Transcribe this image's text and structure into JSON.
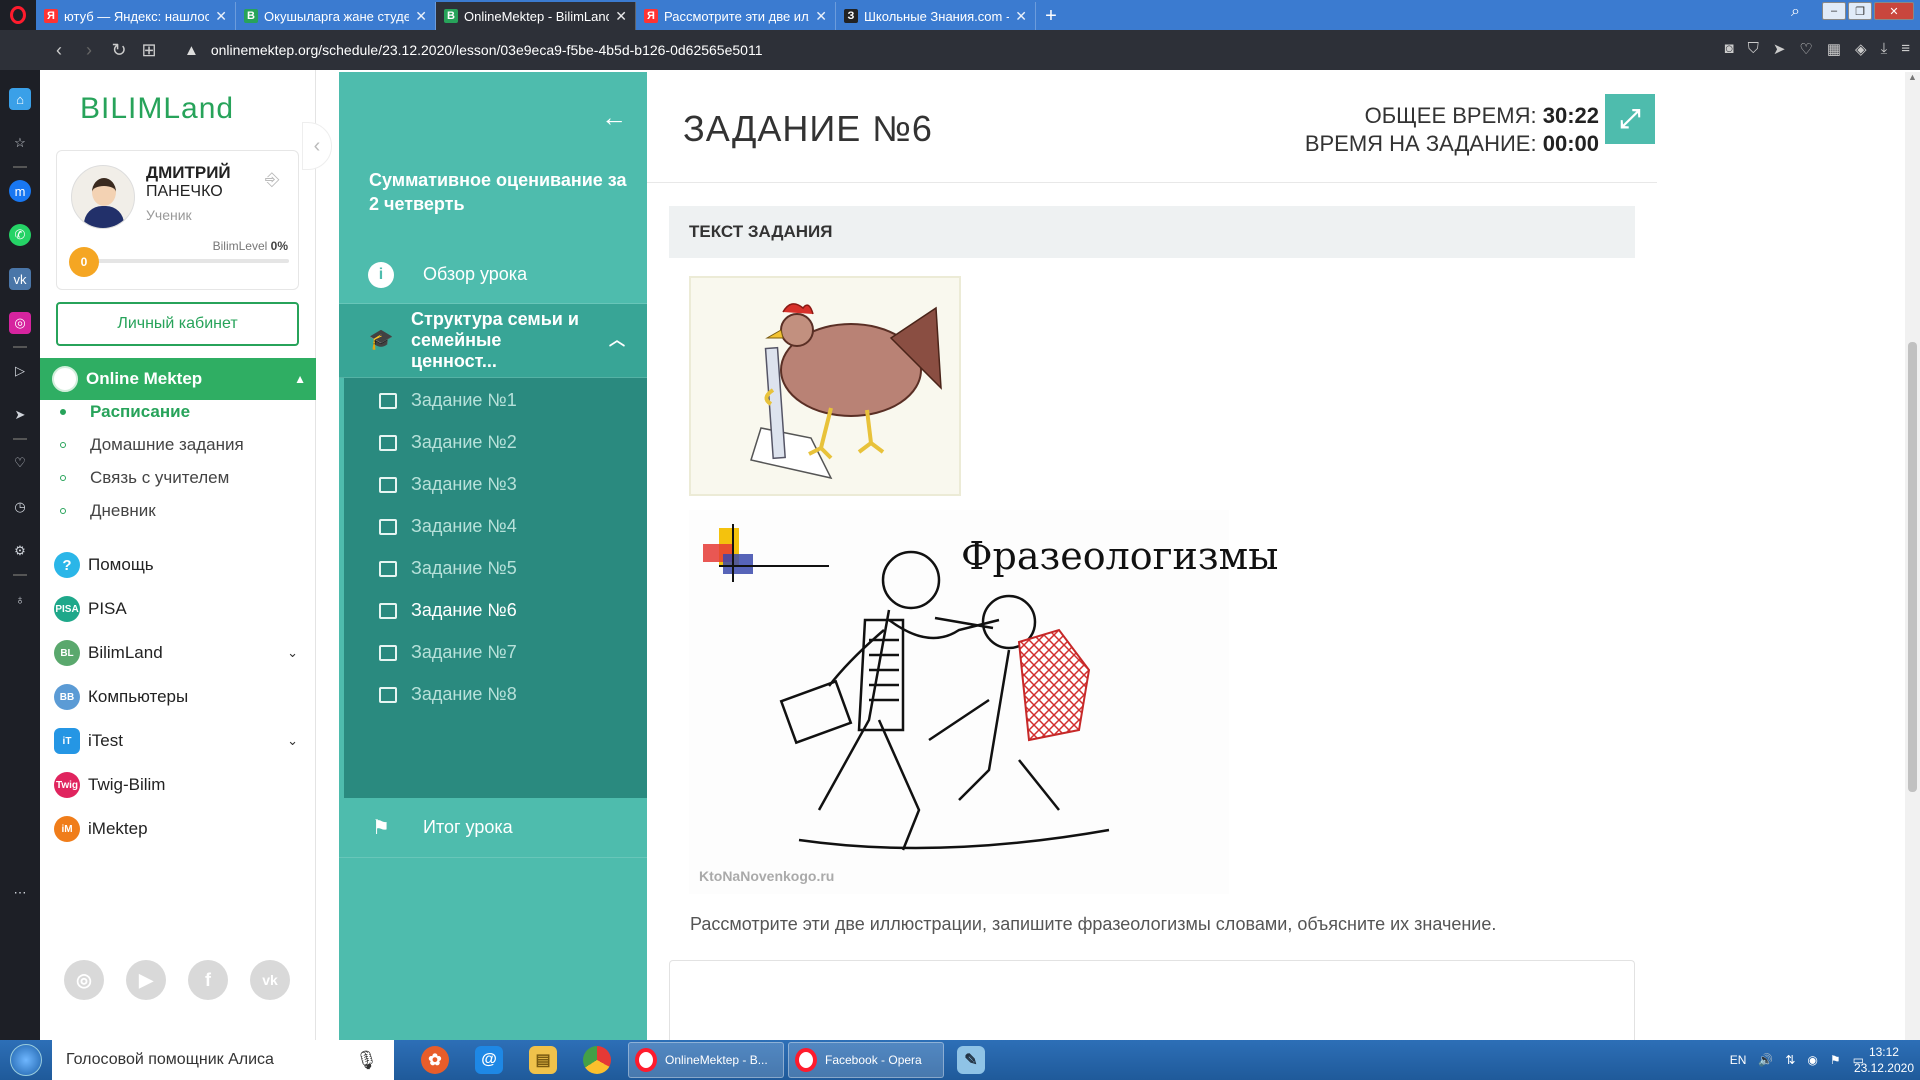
{
  "browser": {
    "tabs": [
      {
        "favicon": "yandex-icon",
        "color": "#ff3333",
        "letter": "Я",
        "title": "ютуб — Яндекс: нашлось"
      },
      {
        "favicon": "bilimland-icon",
        "color": "#27a35a",
        "letter": "B",
        "title": "Окушыларга жане студен"
      },
      {
        "favicon": "bilimland-icon",
        "color": "#27a35a",
        "letter": "B",
        "title": "OnlineMektep - BilimLand"
      },
      {
        "favicon": "yandex-icon",
        "color": "#ff3333",
        "letter": "Я",
        "title": "Рассмотрите эти две илл"
      },
      {
        "favicon": "znanija-icon",
        "color": "#222222",
        "letter": "З",
        "title": "Школьные Знания.com - F"
      }
    ],
    "active_tab": 2,
    "url": "onlinemektep.org/schedule/23.12.2020/lesson/03e9eca9-f5be-4b5d-b126-0d62565e5011"
  },
  "sidebar": {
    "logo": "BILIMLand",
    "user": {
      "first_name": "ДМИТРИЙ",
      "last_name": "ПАНЕЧКО",
      "role": "Ученик",
      "level_label": "BilimLevel",
      "level_percent": "0%",
      "level_badge": "0"
    },
    "cabinet_button": "Личный кабинет",
    "section": "Online Mektep",
    "submenu": [
      "Расписание",
      "Домашние задания",
      "Связь с учителем",
      "Дневник"
    ],
    "menu": [
      {
        "label": "Помощь",
        "icon": "help-icon",
        "color": "#2bb6e8",
        "glyph": "?"
      },
      {
        "label": "PISA",
        "icon": "pisa-icon",
        "color": "#1fa88a",
        "glyph": "PISA"
      },
      {
        "label": "BilimLand",
        "icon": "bilimland-icon",
        "color": "#5aa86d",
        "glyph": "BL"
      },
      {
        "label": "Компьютеры",
        "icon": "bilimbook-icon",
        "color": "#5b9bd5",
        "glyph": "BB"
      },
      {
        "label": "iTest",
        "icon": "itest-icon",
        "color": "#2596e4",
        "glyph": "iT"
      },
      {
        "label": "Twig-Bilim",
        "icon": "twig-icon",
        "color": "#e0245e",
        "glyph": "Twig"
      },
      {
        "label": "iMektep",
        "icon": "imektep-icon",
        "color": "#f07d1a",
        "glyph": "iM"
      }
    ]
  },
  "lesson": {
    "title": "Суммативное оценивание за 2 четверть",
    "overview": "Обзор урока",
    "topic": "Структура семьи и семейные ценност...",
    "tasks": [
      "Задание №1",
      "Задание №2",
      "Задание №3",
      "Задание №4",
      "Задание №5",
      "Задание №6",
      "Задание №7",
      "Задание №8"
    ],
    "active_task": 5,
    "summary": "Итог урока"
  },
  "main": {
    "title": "ЗАДАНИЕ №6",
    "total_time_label": "ОБЩЕЕ ВРЕМЯ:",
    "total_time": "30:22",
    "task_time_label": "ВРЕМЯ НА ЗАДАНИЕ:",
    "task_time": "00:00",
    "section_header": "ТЕКСТ ЗАДАНИЯ",
    "image2_title": "Фразеологизмы",
    "image2_credit": "KtoNaNovenkogo.ru",
    "question": "Рассмотрите эти две иллюстрации, запишите фразеологизмы словами, объясните их значение."
  },
  "taskbar": {
    "search_placeholder": "Голосовой помощник Алиса",
    "tasks": [
      "OnlineMektep - B...",
      "Facebook - Opera"
    ],
    "lang": "EN",
    "time": "13:12",
    "date": "23.12.2020"
  },
  "colors": {
    "brand_green": "#27a35a",
    "lesson_teal": "#4ebcad",
    "lesson_dark": "#2a8a7f"
  }
}
